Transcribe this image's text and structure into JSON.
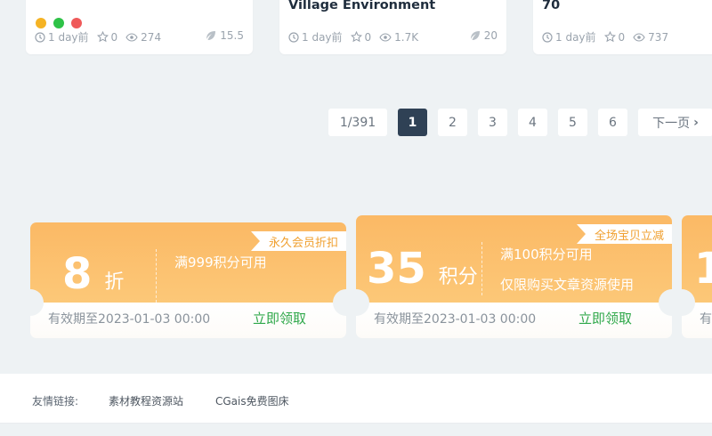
{
  "posts": [
    {
      "title": "",
      "time": "1 day前",
      "likes": "0",
      "views": "274",
      "points": "15.5",
      "window_dots": [
        "#f5b324",
        "#2ec247",
        "#ef5a5a"
      ]
    },
    {
      "title": "Village Environment",
      "time": "1 day前",
      "likes": "0",
      "views": "1.7K",
      "points": "20"
    },
    {
      "title": "70",
      "time": "1 day前",
      "likes": "0",
      "views": "737"
    }
  ],
  "pagination": {
    "info": "1/391",
    "pages": [
      "1",
      "2",
      "3",
      "4",
      "5",
      "6"
    ],
    "active": "1",
    "next_label": "下一页"
  },
  "coupons": [
    {
      "tag": "永久会员折扣",
      "amount": "8",
      "unit": "折",
      "conditions": [
        "满999积分可用"
      ],
      "expire": "有效期至2023-01-03 00:00",
      "claim_label": "立即领取"
    },
    {
      "tag": "全场宝贝立减",
      "amount": "35",
      "unit": "积分",
      "conditions": [
        "满100积分可用",
        "仅限购买文章资源使用"
      ],
      "expire": "有效期至2023-01-03 00:00",
      "claim_label": "立即领取"
    },
    {
      "amount": "1",
      "expire": "有"
    }
  ],
  "footer": {
    "label": "友情链接:",
    "links": [
      "素材教程资源站",
      "CGais免费图床"
    ]
  },
  "colors": {
    "accent_dark": "#2f4155",
    "coupon_orange": "#fbb965",
    "claim_green": "#2fa84a"
  }
}
